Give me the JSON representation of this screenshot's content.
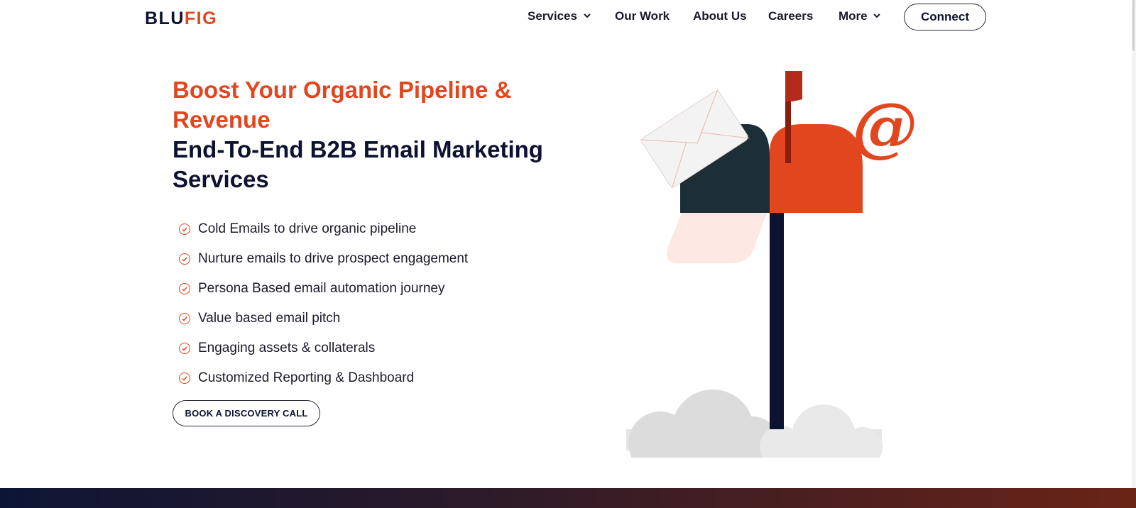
{
  "header": {
    "logo": {
      "part1": "BLU",
      "part2": "FIG"
    },
    "nav": [
      {
        "label": "Services",
        "has_dropdown": true
      },
      {
        "label": "Our Work",
        "has_dropdown": false
      },
      {
        "label": "About Us",
        "has_dropdown": false
      },
      {
        "label": "Careers",
        "has_dropdown": false
      },
      {
        "label": "More",
        "has_dropdown": true
      }
    ],
    "connect_label": "Connect"
  },
  "hero": {
    "headline_orange": "Boost Your Organic Pipeline & Revenue",
    "headline_dark": "End-To-End B2B Email Marketing Services",
    "features": [
      "Cold Emails to drive organic pipeline",
      "Nurture emails to drive prospect engagement",
      "Persona Based email automation journey",
      "Value based email pitch",
      "Engaging assets & collaterals",
      "Customized Reporting & Dashboard"
    ],
    "cta_label": "BOOK A DISCOVERY CALL",
    "illustration_symbol": "@"
  },
  "colors": {
    "brand_orange": "#e2461f",
    "brand_navy": "#0d1230",
    "mailbox_dark": "#1c2f36",
    "flag_red": "#b52a1a"
  },
  "icons": {
    "check": "check-circle-icon",
    "dropdown": "chevron-down-icon",
    "mail": "envelope-icon",
    "at": "at-symbol-icon"
  }
}
